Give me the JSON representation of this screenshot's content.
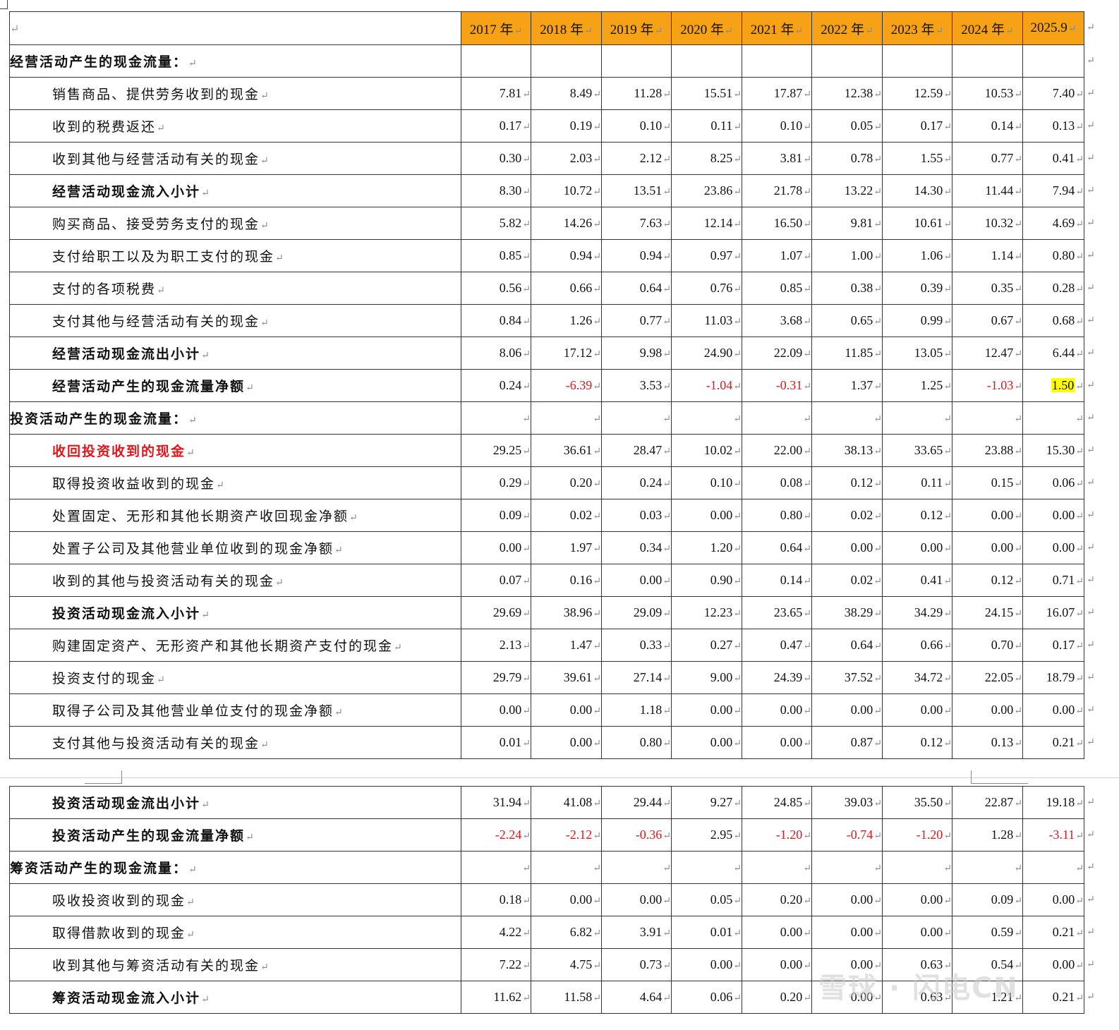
{
  "return_mark": "↵",
  "header": {
    "years": [
      "2017 年",
      "2018 年",
      "2019 年",
      "2020 年",
      "2021 年",
      "2022 年",
      "2023 年",
      "2024 年",
      "2025.9"
    ]
  },
  "table1_rows": [
    {
      "label": "经营活动产生的现金流量：",
      "style": "section",
      "values": []
    },
    {
      "label": "销售商品、提供劳务收到的现金",
      "style": "item",
      "values": [
        "7.81",
        "8.49",
        "11.28",
        "15.51",
        "17.87",
        "12.38",
        "12.59",
        "10.53",
        "7.40"
      ]
    },
    {
      "label": "收到的税费返还",
      "style": "item",
      "values": [
        "0.17",
        "0.19",
        "0.10",
        "0.11",
        "0.10",
        "0.05",
        "0.17",
        "0.14",
        "0.13"
      ]
    },
    {
      "label": "收到其他与经营活动有关的现金",
      "style": "item",
      "values": [
        "0.30",
        "2.03",
        "2.12",
        "8.25",
        "3.81",
        "0.78",
        "1.55",
        "0.77",
        "0.41"
      ]
    },
    {
      "label": "经营活动现金流入小计",
      "style": "subtotal",
      "values": [
        "8.30",
        "10.72",
        "13.51",
        "23.86",
        "21.78",
        "13.22",
        "14.30",
        "11.44",
        "7.94"
      ]
    },
    {
      "label": "购买商品、接受劳务支付的现金",
      "style": "item",
      "values": [
        "5.82",
        "14.26",
        "7.63",
        "12.14",
        "16.50",
        "9.81",
        "10.61",
        "10.32",
        "4.69"
      ]
    },
    {
      "label": "支付给职工以及为职工支付的现金",
      "style": "item",
      "values": [
        "0.85",
        "0.94",
        "0.94",
        "0.97",
        "1.07",
        "1.00",
        "1.06",
        "1.14",
        "0.80"
      ]
    },
    {
      "label": "支付的各项税费",
      "style": "item",
      "values": [
        "0.56",
        "0.66",
        "0.64",
        "0.76",
        "0.85",
        "0.38",
        "0.39",
        "0.35",
        "0.28"
      ]
    },
    {
      "label": "支付其他与经营活动有关的现金",
      "style": "item",
      "values": [
        "0.84",
        "1.26",
        "0.77",
        "11.03",
        "3.68",
        "0.65",
        "0.99",
        "0.67",
        "0.68"
      ]
    },
    {
      "label": "经营活动现金流出小计",
      "style": "subtotal",
      "values": [
        "8.06",
        "17.12",
        "9.98",
        "24.90",
        "22.09",
        "11.85",
        "13.05",
        "12.47",
        "6.44"
      ]
    },
    {
      "label": "经营活动产生的现金流量净额",
      "style": "subtotal",
      "values": [
        "0.24",
        "-6.39",
        "3.53",
        "-1.04",
        "-0.31",
        "1.37",
        "1.25",
        "-1.03",
        "1.50"
      ],
      "highlight_last": true
    },
    {
      "label": "投资活动产生的现金流量：",
      "style": "section",
      "values": [
        "",
        "",
        "",
        "",
        "",
        "",
        "",
        "",
        ""
      ]
    },
    {
      "label": "收回投资收到的现金",
      "style": "red",
      "values": [
        "29.25",
        "36.61",
        "28.47",
        "10.02",
        "22.00",
        "38.13",
        "33.65",
        "23.88",
        "15.30"
      ]
    },
    {
      "label": "取得投资收益收到的现金",
      "style": "item",
      "values": [
        "0.29",
        "0.20",
        "0.24",
        "0.10",
        "0.08",
        "0.12",
        "0.11",
        "0.15",
        "0.06"
      ]
    },
    {
      "label": "处置固定、无形和其他长期资产收回现金净额",
      "style": "item",
      "values": [
        "0.09",
        "0.02",
        "0.03",
        "0.00",
        "0.80",
        "0.02",
        "0.12",
        "0.00",
        "0.00"
      ]
    },
    {
      "label": "处置子公司及其他营业单位收到的现金净额",
      "style": "item",
      "values": [
        "0.00",
        "1.97",
        "0.34",
        "1.20",
        "0.64",
        "0.00",
        "0.00",
        "0.00",
        "0.00"
      ]
    },
    {
      "label": "收到的其他与投资活动有关的现金",
      "style": "item",
      "values": [
        "0.07",
        "0.16",
        "0.00",
        "0.90",
        "0.14",
        "0.02",
        "0.41",
        "0.12",
        "0.71"
      ]
    },
    {
      "label": "投资活动现金流入小计",
      "style": "subtotal",
      "values": [
        "29.69",
        "38.96",
        "29.09",
        "12.23",
        "23.65",
        "38.29",
        "34.29",
        "24.15",
        "16.07"
      ]
    },
    {
      "label": "购建固定资产、无形资产和其他长期资产支付的现金",
      "style": "item",
      "values": [
        "2.13",
        "1.47",
        "0.33",
        "0.27",
        "0.47",
        "0.64",
        "0.66",
        "0.70",
        "0.17"
      ]
    },
    {
      "label": "投资支付的现金",
      "style": "item",
      "values": [
        "29.79",
        "39.61",
        "27.14",
        "9.00",
        "24.39",
        "37.52",
        "34.72",
        "22.05",
        "18.79"
      ]
    },
    {
      "label": "取得子公司及其他营业单位支付的现金净额",
      "style": "item",
      "values": [
        "0.00",
        "0.00",
        "1.18",
        "0.00",
        "0.00",
        "0.00",
        "0.00",
        "0.00",
        "0.00"
      ]
    },
    {
      "label": "支付其他与投资活动有关的现金",
      "style": "item",
      "values": [
        "0.01",
        "0.00",
        "0.80",
        "0.00",
        "0.00",
        "0.87",
        "0.12",
        "0.13",
        "0.21"
      ]
    }
  ],
  "table2_rows": [
    {
      "label": "投资活动现金流出小计",
      "style": "subtotal",
      "values": [
        "31.94",
        "41.08",
        "29.44",
        "9.27",
        "24.85",
        "39.03",
        "35.50",
        "22.87",
        "19.18"
      ]
    },
    {
      "label": "投资活动产生的现金流量净额",
      "style": "subtotal",
      "values": [
        "-2.24",
        "-2.12",
        "-0.36",
        "2.95",
        "-1.20",
        "-0.74",
        "-1.20",
        "1.28",
        "-3.11"
      ]
    },
    {
      "label": "筹资活动产生的现金流量：",
      "style": "section",
      "values": [
        "",
        "",
        "",
        "",
        "",
        "",
        "",
        "",
        ""
      ]
    },
    {
      "label": "吸收投资收到的现金",
      "style": "item",
      "values": [
        "0.18",
        "0.00",
        "0.00",
        "0.05",
        "0.20",
        "0.00",
        "0.00",
        "0.09",
        "0.00"
      ]
    },
    {
      "label": "取得借款收到的现金",
      "style": "item",
      "values": [
        "4.22",
        "6.82",
        "3.91",
        "0.01",
        "0.00",
        "0.00",
        "0.00",
        "0.59",
        "0.21"
      ]
    },
    {
      "label": "收到其他与筹资活动有关的现金",
      "style": "item",
      "values": [
        "7.22",
        "4.75",
        "0.73",
        "0.00",
        "0.00",
        "0.00",
        "0.63",
        "0.54",
        "0.00"
      ]
    },
    {
      "label": "筹资活动现金流入小计",
      "style": "subtotal",
      "values": [
        "11.62",
        "11.58",
        "4.64",
        "0.06",
        "0.20",
        "0.00",
        "0.63",
        "1.21",
        "0.21"
      ]
    }
  ],
  "watermark": "雪球 · 闪电CN",
  "colors": {
    "header_bg": "#f7a117",
    "negative": "#e0161c",
    "highlight": "#ffff00"
  }
}
